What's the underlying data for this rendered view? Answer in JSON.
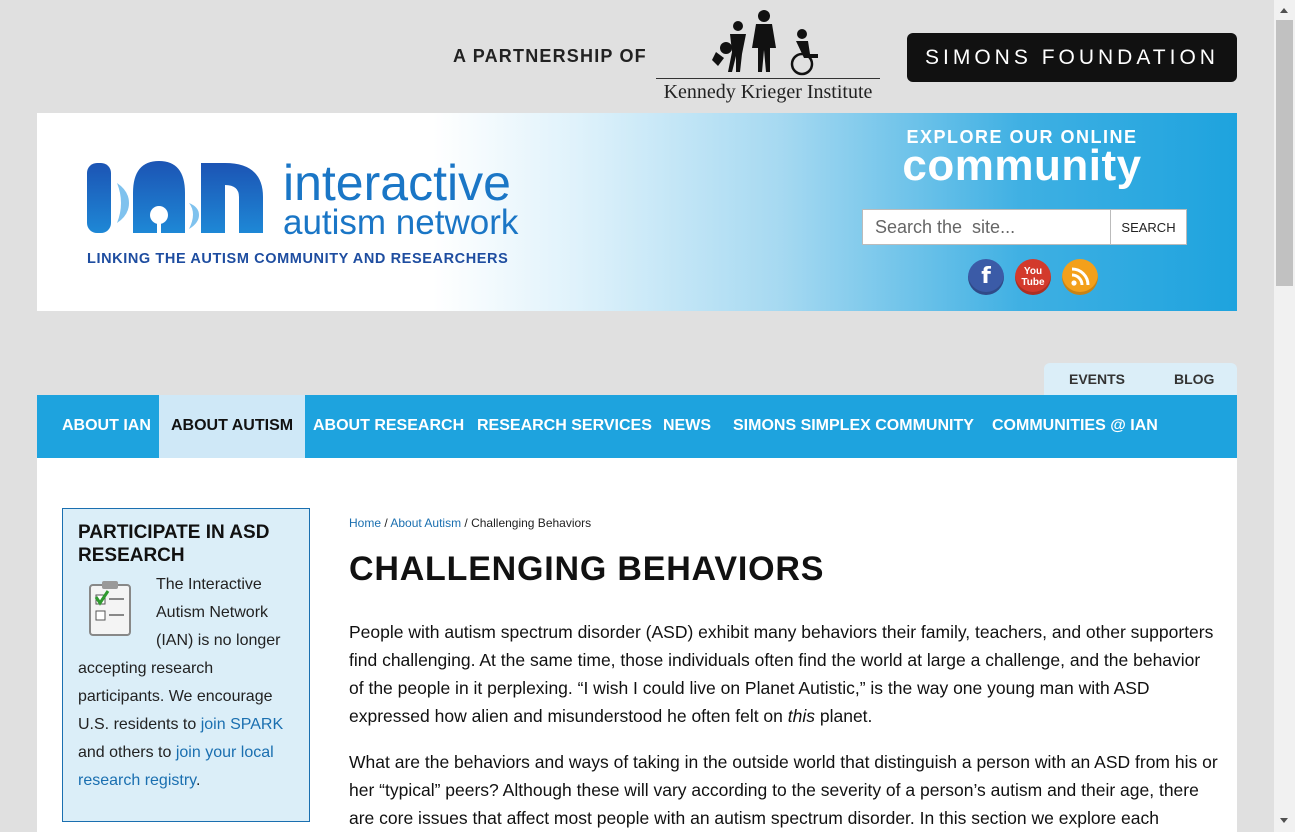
{
  "partner": {
    "label": "A PARTNERSHIP OF",
    "kki": "Kennedy Krieger Institute",
    "simons": "SIMONS FOUNDATION"
  },
  "banner": {
    "logo_line1": "interactive",
    "logo_line2": "autism network",
    "logo_tagline": "LINKING THE AUTISM COMMUNITY AND RESEARCHERS",
    "explore": "EXPLORE OUR ONLINE",
    "community": "community",
    "search_placeholder": "Search the  site...",
    "search_button": "SEARCH",
    "social": {
      "facebook": "f",
      "youtube": "You Tube",
      "rss": "))"
    }
  },
  "sub_links": [
    "EVENTS",
    "BLOG"
  ],
  "nav": [
    "ABOUT IAN",
    "ABOUT AUTISM",
    "ABOUT RESEARCH",
    "RESEARCH SERVICES",
    "NEWS",
    "SIMONS SIMPLEX COMMUNITY",
    "COMMUNITIES @ IAN"
  ],
  "nav_active": "ABOUT AUTISM",
  "sidebar": {
    "title": "PARTICIPATE IN ASD RESEARCH",
    "text1": "The Interactive Autism Network (IAN) is no longer accepting research participants. We encourage U.S. residents to ",
    "link1": "join SPARK",
    "text2": " and others to ",
    "link2": "join your local research registry",
    "text3": "."
  },
  "breadcrumb": {
    "home": "Home",
    "sep": " / ",
    "section": "About Autism",
    "current": "Challenging Behaviors"
  },
  "page_title": "CHALLENGING BEHAVIORS",
  "paragraph1": {
    "before": "People with autism spectrum disorder (ASD) exhibit many behaviors their family, teachers, and other supporters find challenging. At the same time, those individuals often find the world at large a challenge, and the behavior of the people in it perplexing. “I wish I could live on Planet Autistic,” is the way one young man with ASD expressed how alien and misunderstood he often felt on ",
    "emphasis": "this",
    "after": " planet."
  },
  "paragraph2": "What are the behaviors and ways of taking in the outside world that distinguish a person with an ASD from his or her “typical” peers? Although these will vary according to the severity of a person’s autism and their age, there are core issues that affect most people with an autism spectrum disorder. In this section we explore each",
  "colors": {
    "brand_blue": "#1ea3de",
    "logo_blue": "#1a76c6",
    "link": "#1a6fb0"
  }
}
